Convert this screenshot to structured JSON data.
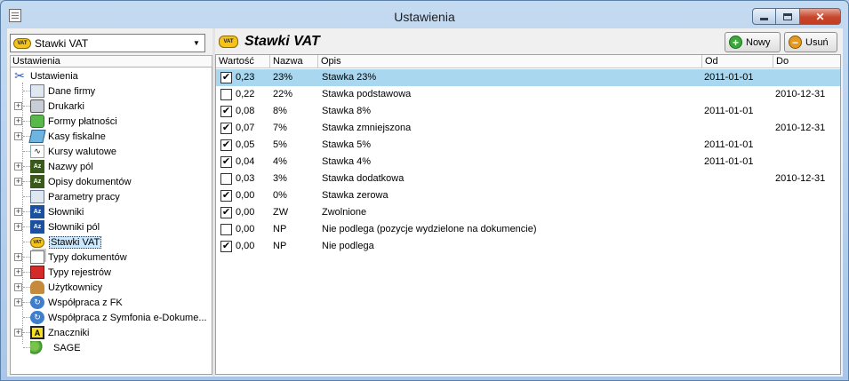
{
  "window": {
    "title": "Ustawienia"
  },
  "left": {
    "combo": {
      "badge": "VAT",
      "value": "Stawki VAT"
    },
    "tree_header": "Ustawienia",
    "root": "Ustawienia",
    "items": [
      {
        "label": "Dane firmy",
        "icon": "company-data-icon",
        "expandable": false
      },
      {
        "label": "Drukarki",
        "icon": "printer-icon",
        "expandable": true
      },
      {
        "label": "Formy płatności",
        "icon": "payment-forms-icon",
        "expandable": true
      },
      {
        "label": "Kasy fiskalne",
        "icon": "cash-register-icon",
        "expandable": true
      },
      {
        "label": "Kursy walutowe",
        "icon": "exchange-rates-icon",
        "expandable": false
      },
      {
        "label": "Nazwy pól",
        "icon": "field-names-icon",
        "expandable": true
      },
      {
        "label": "Opisy dokumentów",
        "icon": "document-descriptions-icon",
        "expandable": true
      },
      {
        "label": "Parametry pracy",
        "icon": "work-parameters-icon",
        "expandable": false
      },
      {
        "label": "Słowniki",
        "icon": "dictionaries-icon",
        "expandable": true
      },
      {
        "label": "Słowniki pól",
        "icon": "field-dictionaries-icon",
        "expandable": true
      },
      {
        "label": "Stawki VAT",
        "icon": "vat-icon",
        "expandable": false,
        "selected": true
      },
      {
        "label": "Typy dokumentów",
        "icon": "document-types-icon",
        "expandable": true
      },
      {
        "label": "Typy rejestrów",
        "icon": "register-types-icon",
        "expandable": true
      },
      {
        "label": "Użytkownicy",
        "icon": "users-icon",
        "expandable": true
      },
      {
        "label": "Współpraca z FK",
        "icon": "fk-sync-icon",
        "expandable": true
      },
      {
        "label": "Współpraca z Symfonia e-Dokume...",
        "icon": "edocs-sync-icon",
        "expandable": false
      },
      {
        "label": "Znaczniki",
        "icon": "tags-icon",
        "expandable": true
      },
      {
        "label": "SAGE",
        "icon": "sage-icon",
        "expandable": false
      }
    ]
  },
  "right": {
    "badge": "VAT",
    "title": "Stawki VAT",
    "new_label": "Nowy",
    "delete_label": "Usuń",
    "columns": [
      "Wartość",
      "Nazwa",
      "Opis",
      "Od",
      "Do"
    ],
    "rows": [
      {
        "checked": true,
        "value": "0,23",
        "name": "23%",
        "desc": "Stawka 23%",
        "from": "2011-01-01",
        "to": "",
        "selected": true
      },
      {
        "checked": false,
        "value": "0,22",
        "name": "22%",
        "desc": "Stawka podstawowa",
        "from": "",
        "to": "2010-12-31"
      },
      {
        "checked": true,
        "value": "0,08",
        "name": "8%",
        "desc": "Stawka 8%",
        "from": "2011-01-01",
        "to": ""
      },
      {
        "checked": true,
        "value": "0,07",
        "name": "7%",
        "desc": "Stawka zmniejszona",
        "from": "",
        "to": "2010-12-31"
      },
      {
        "checked": true,
        "value": "0,05",
        "name": "5%",
        "desc": "Stawka 5%",
        "from": "2011-01-01",
        "to": ""
      },
      {
        "checked": true,
        "value": "0,04",
        "name": "4%",
        "desc": "Stawka 4%",
        "from": "2011-01-01",
        "to": ""
      },
      {
        "checked": false,
        "value": "0,03",
        "name": "3%",
        "desc": "Stawka dodatkowa",
        "from": "",
        "to": "2010-12-31"
      },
      {
        "checked": true,
        "value": "0,00",
        "name": "0%",
        "desc": "Stawka zerowa",
        "from": "",
        "to": ""
      },
      {
        "checked": true,
        "value": "0,00",
        "name": "ZW",
        "desc": "Zwolnione",
        "from": "",
        "to": ""
      },
      {
        "checked": false,
        "value": "0,00",
        "name": "NP",
        "desc": "Nie podlega (pozycje wydzielone na dokumencie)",
        "from": "",
        "to": ""
      },
      {
        "checked": true,
        "value": "0,00",
        "name": "NP",
        "desc": "Nie podlega",
        "from": "",
        "to": ""
      }
    ]
  }
}
